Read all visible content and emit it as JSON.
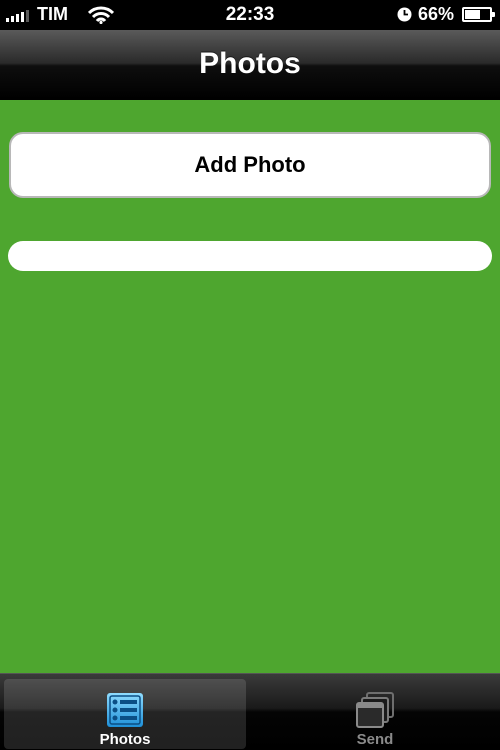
{
  "status_bar": {
    "carrier": "TIM",
    "time": "22:33",
    "battery_percent": "66%",
    "battery_level": 0.66,
    "icons": [
      "signal-icon",
      "wifi-icon",
      "clock-icon",
      "battery-icon"
    ]
  },
  "nav_bar": {
    "title": "Photos"
  },
  "main": {
    "add_photo_label": "Add Photo"
  },
  "tab_bar": {
    "tabs": [
      {
        "label": "Photos",
        "icon": "list-icon",
        "selected": true
      },
      {
        "label": "Send",
        "icon": "windows-icon",
        "selected": false
      }
    ]
  },
  "colors": {
    "background": "#4ea62f",
    "tab_selected_icon": "#3ab0f0",
    "tab_unselected_label": "#8a8a8a"
  }
}
